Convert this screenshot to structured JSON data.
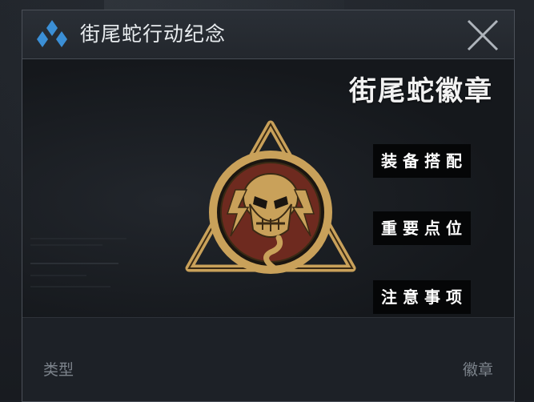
{
  "window": {
    "title": "街尾蛇行动纪念",
    "logo_icon": "blue-diamond-cluster-icon",
    "close_icon": "close-x-icon"
  },
  "main": {
    "badge_title": "街尾蛇徽章",
    "emblem_icon": "shadow-company-skull-badge-icon",
    "tags": [
      "装备搭配",
      "重要点位",
      "注意事项"
    ]
  },
  "info": {
    "label": "类型",
    "value": "徽章"
  },
  "colors": {
    "accent_blue": "#3b8fd6",
    "badge_gold": "#c9a15a",
    "badge_red": "#7a2a1e"
  }
}
